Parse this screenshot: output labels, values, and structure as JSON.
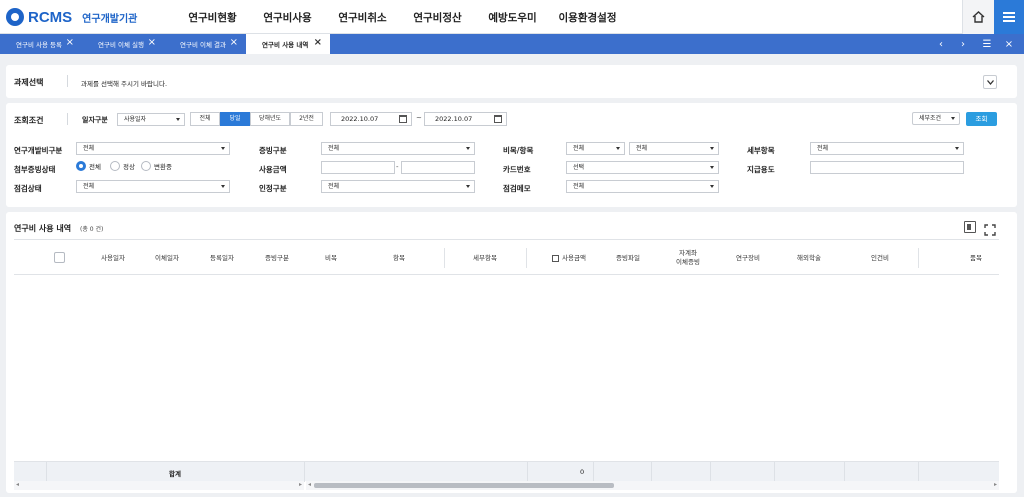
{
  "header": {
    "brand": "RCMS",
    "org": "연구개발기관",
    "nav": [
      "연구비현황",
      "연구비사용",
      "연구비취소",
      "연구비정산",
      "예방도우미",
      "이용환경설정"
    ]
  },
  "tabs": [
    {
      "label": "연구비 사용 등록"
    },
    {
      "label": "연구비 이체 실행"
    },
    {
      "label": "연구비 이체 결과"
    },
    {
      "label": "연구비 사용 내역"
    }
  ],
  "project": {
    "label": "과제선택",
    "message": "과제를 선택해 주시기 바랍니다."
  },
  "search": {
    "label": "조회조건",
    "date_type_label": "일자구분",
    "date_type_value": "사용일자",
    "range_buttons": [
      "전체",
      "당일",
      "당해년도",
      "2년전"
    ],
    "date_from": "2022.10.07",
    "tilde": "~",
    "date_to": "2022.10.07",
    "detail_label": "세부조건",
    "search_button": "조회",
    "fields": {
      "rd_type_label": "연구개발비구분",
      "rd_type_value": "전체",
      "evidence_type_label": "증빙구분",
      "evidence_type_value": "전체",
      "category_label": "비목/항목",
      "category_value": "전체",
      "item_value": "전체",
      "sub_item_label": "세부항목",
      "sub_item_value": "전체",
      "attach_label": "첨부증빙상태",
      "attach_opts": [
        "전체",
        "정상",
        "변환중"
      ],
      "amount_label": "사용금액",
      "amount_sep": "-",
      "card_label": "카드번호",
      "card_value": "선택",
      "purpose_label": "지급용도",
      "check_label": "점검상태",
      "check_value": "전체",
      "cert_label": "인정구분",
      "cert_value": "전체",
      "memo_label": "점검메모",
      "memo_value": "전체"
    }
  },
  "results": {
    "title": "연구비 사용 내역",
    "count": "(총 0 건)",
    "columns": [
      "사용일자",
      "이체일자",
      "등록일자",
      "증빙구분",
      "비목",
      "항목",
      "세부항목",
      "사용금액",
      "증빙파일",
      "자계좌\n이체증빙",
      "연구장비",
      "해외학술",
      "인건비",
      "품목"
    ],
    "total_label": "합계",
    "total_value": "0"
  },
  "colors": {
    "primary": "#2b7ad8",
    "tabbar": "#3c6fcc",
    "search_button": "#2b9de0"
  }
}
